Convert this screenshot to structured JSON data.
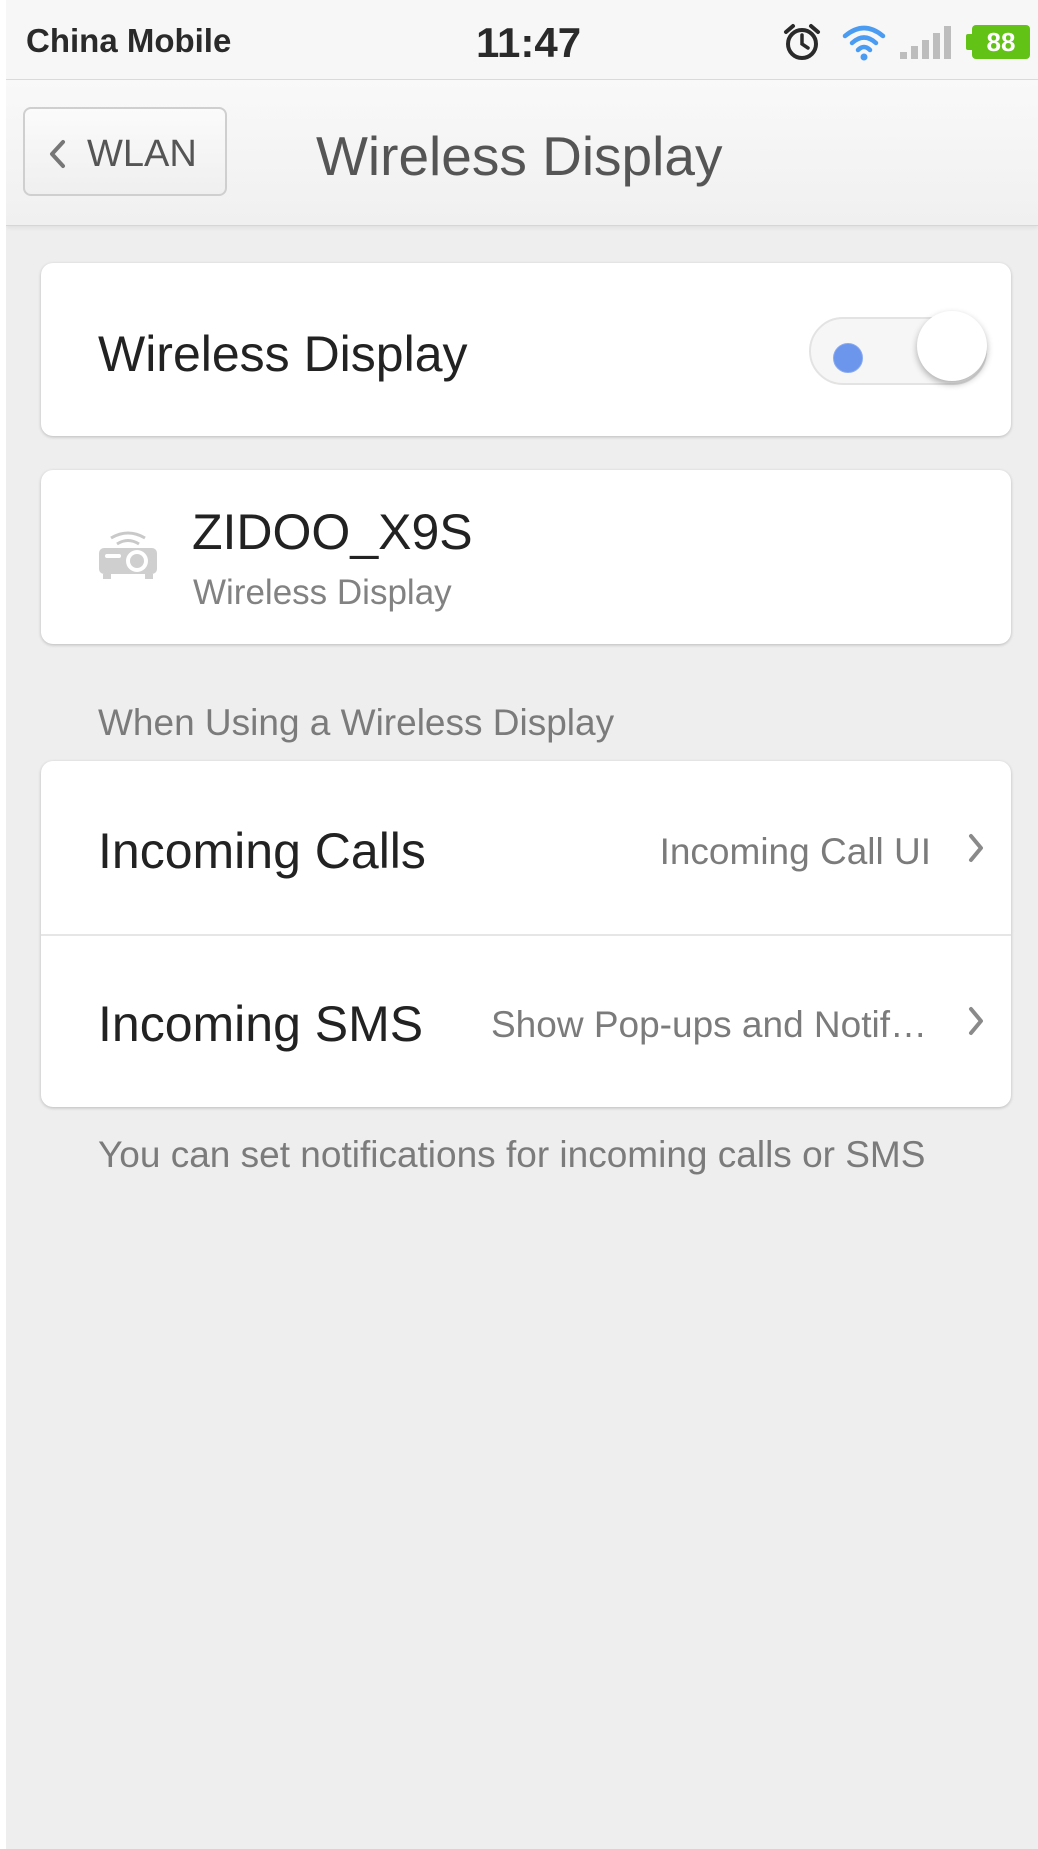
{
  "status_bar": {
    "carrier": "China Mobile",
    "time": "11:47",
    "battery_level": "88",
    "icons": [
      "alarm-icon",
      "wifi-icon",
      "signal-icon",
      "battery-icon"
    ]
  },
  "nav": {
    "back_label": "WLAN",
    "title": "Wireless Display"
  },
  "toggle_card": {
    "label": "Wireless Display",
    "enabled": false
  },
  "device": {
    "name": "ZIDOO_X9S",
    "subtitle": "Wireless Display",
    "icon": "projector-icon"
  },
  "section_header": "When Using a Wireless Display",
  "options": [
    {
      "label": "Incoming Calls",
      "value": "Incoming Call UI"
    },
    {
      "label": "Incoming SMS",
      "value": "Show Pop-ups and Notifications"
    }
  ],
  "footer_note": "You can set notifications for incoming calls or SMS",
  "colors": {
    "accent": "#6b96ec",
    "battery": "#62c216",
    "wifi": "#4a9bf2",
    "background": "#eeeeee",
    "card": "#ffffff"
  }
}
